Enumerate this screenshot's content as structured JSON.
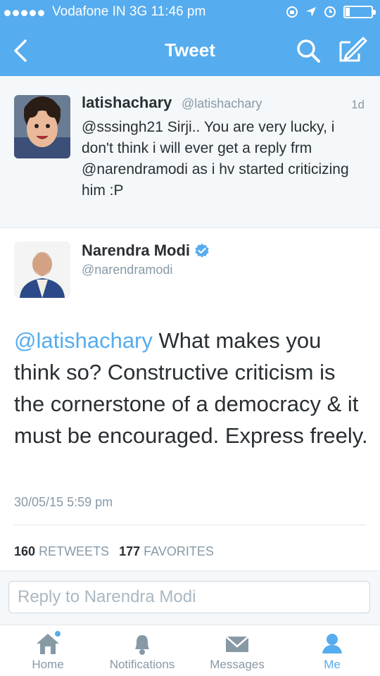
{
  "status_bar": {
    "carrier": "Vodafone IN",
    "network": "3G",
    "time": "11:46 pm",
    "battery_level": 0.15
  },
  "nav": {
    "title": "Tweet",
    "icons": [
      "back-chevron-icon",
      "search-icon",
      "compose-icon"
    ]
  },
  "reply_tweet": {
    "name": "latishachary",
    "handle": "@latishachary",
    "time": "1d",
    "text": "@sssingh21 Sirji.. You are very lucky, i don't think i will ever get a reply frm @narendramodi as i hv started criticizing him :P"
  },
  "main_tweet": {
    "name": "Narendra Modi",
    "verified": true,
    "handle": "@narendramodi",
    "mention": "@latishachary",
    "text": " What makes you think so? Constructive criticism is the cornerstone of a democracy & it must be encouraged. Express freely.",
    "date": "30/05/15 5:59 pm",
    "retweets_count": "160",
    "retweets_label": "RETWEETS",
    "favorites_count": "177",
    "favorites_label": "FAVORITES"
  },
  "reply_bar": {
    "placeholder": "Reply to Narendra Modi"
  },
  "tabbar": {
    "tabs": [
      {
        "label": "Home",
        "icon": "home-icon"
      },
      {
        "label": "Notifications",
        "icon": "bell-icon"
      },
      {
        "label": "Messages",
        "icon": "envelope-icon"
      },
      {
        "label": "Me",
        "icon": "person-icon"
      }
    ],
    "active": "Me"
  },
  "colors": {
    "accent": "#55acee",
    "text": "#292f33",
    "muted": "#8899a6"
  }
}
